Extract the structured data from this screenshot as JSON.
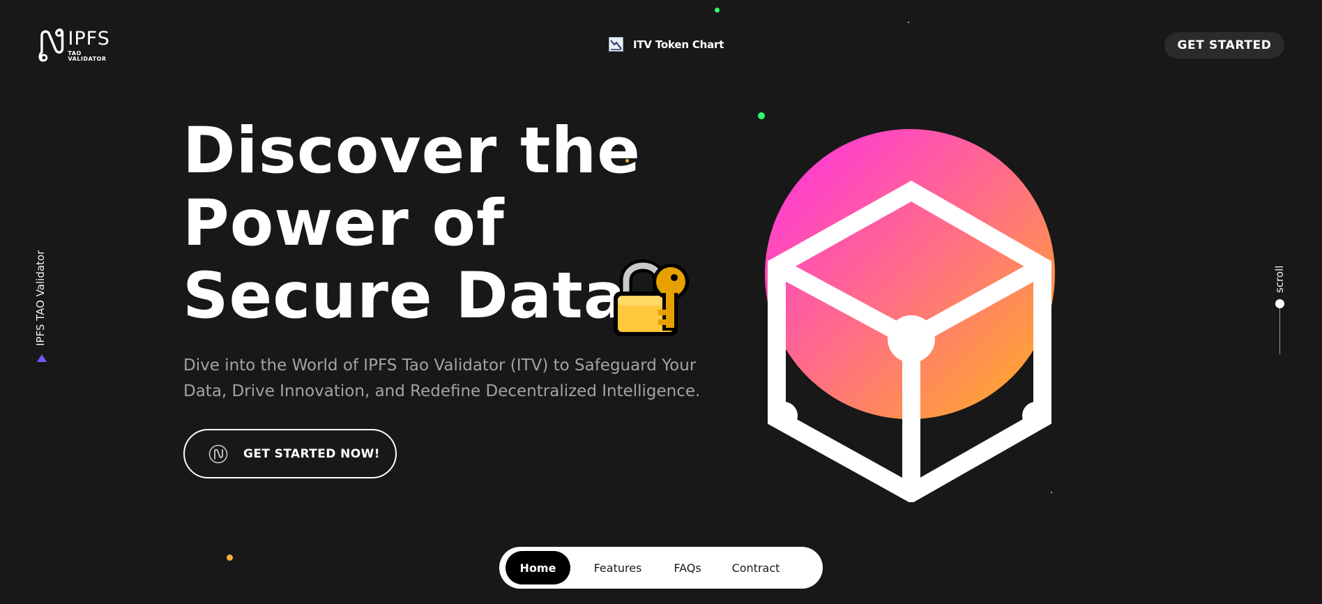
{
  "header": {
    "logo": {
      "main": "IPFS",
      "sub": "TAO VALIDATOR"
    },
    "chart_link_label": "ITV Token Chart",
    "cta_label": "GET STARTED"
  },
  "side": {
    "left_label": "IPFS TAO Validator",
    "scroll_label": "scroll"
  },
  "hero": {
    "title_lines": [
      "Discover the",
      "Power of",
      "Secure Data"
    ],
    "subtitle_lines": [
      "Dive into the World of IPFS Tao Validator (ITV) to Safeguard Your",
      "Data, Drive Innovation, and Redefine Decentralized Intelligence."
    ],
    "cta_label": "GET STARTED NOW!",
    "emoji_icon": "lock-with-key-icon"
  },
  "bottom_nav": {
    "items": [
      {
        "label": "Home",
        "active": true
      },
      {
        "label": "Features",
        "active": false
      },
      {
        "label": "FAQs",
        "active": false
      },
      {
        "label": "Contract",
        "active": false
      }
    ]
  },
  "colors": {
    "background": "#181818",
    "gradient_start": "#ff2fe6",
    "gradient_end": "#ffb21a",
    "accent_purple": "#6a5cff",
    "dot_green": "#2bff6a",
    "dot_orange": "#ffad40"
  }
}
